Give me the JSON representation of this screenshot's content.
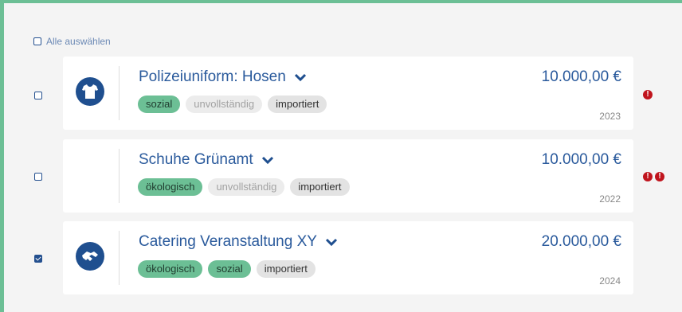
{
  "select_all": {
    "label": "Alle auswählen",
    "checked": false
  },
  "colors": {
    "accent_green": "#6cbf95",
    "primary_blue": "#2a5a9c",
    "icon_blue": "#1f4f8f",
    "warning_red": "#c0141d"
  },
  "items": [
    {
      "title": "Polizeiuniform: Hosen",
      "amount": "10.000,00 €",
      "year": "2023",
      "checked": false,
      "icon": "shirt-icon",
      "tags": [
        {
          "label": "sozial",
          "style": "green"
        },
        {
          "label": "unvollständig",
          "style": "light"
        },
        {
          "label": "importiert",
          "style": "gray"
        }
      ],
      "warnings": [
        "!"
      ]
    },
    {
      "title": "Schuhe Grünamt",
      "amount": "10.000,00 €",
      "year": "2022",
      "checked": false,
      "icon": "",
      "tags": [
        {
          "label": "ökologisch",
          "style": "green"
        },
        {
          "label": "unvollständig",
          "style": "light"
        },
        {
          "label": "importiert",
          "style": "gray"
        }
      ],
      "warnings": [
        "!",
        "!"
      ]
    },
    {
      "title": "Catering Veranstaltung XY",
      "amount": "20.000,00 €",
      "year": "2024",
      "checked": true,
      "icon": "handshake-icon",
      "tags": [
        {
          "label": "ökologisch",
          "style": "green"
        },
        {
          "label": "sozial",
          "style": "green"
        },
        {
          "label": "importiert",
          "style": "gray"
        }
      ],
      "warnings": []
    }
  ]
}
